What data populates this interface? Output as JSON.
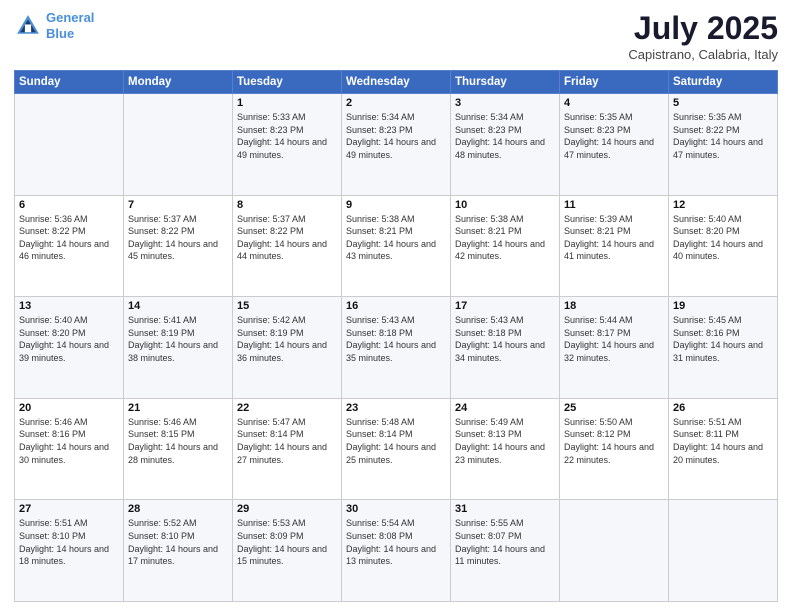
{
  "header": {
    "logo_line1": "General",
    "logo_line2": "Blue",
    "title": "July 2025",
    "subtitle": "Capistrano, Calabria, Italy"
  },
  "weekdays": [
    "Sunday",
    "Monday",
    "Tuesday",
    "Wednesday",
    "Thursday",
    "Friday",
    "Saturday"
  ],
  "weeks": [
    [
      {
        "day": "",
        "sunrise": "",
        "sunset": "",
        "daylight": ""
      },
      {
        "day": "",
        "sunrise": "",
        "sunset": "",
        "daylight": ""
      },
      {
        "day": "1",
        "sunrise": "Sunrise: 5:33 AM",
        "sunset": "Sunset: 8:23 PM",
        "daylight": "Daylight: 14 hours and 49 minutes."
      },
      {
        "day": "2",
        "sunrise": "Sunrise: 5:34 AM",
        "sunset": "Sunset: 8:23 PM",
        "daylight": "Daylight: 14 hours and 49 minutes."
      },
      {
        "day": "3",
        "sunrise": "Sunrise: 5:34 AM",
        "sunset": "Sunset: 8:23 PM",
        "daylight": "Daylight: 14 hours and 48 minutes."
      },
      {
        "day": "4",
        "sunrise": "Sunrise: 5:35 AM",
        "sunset": "Sunset: 8:23 PM",
        "daylight": "Daylight: 14 hours and 47 minutes."
      },
      {
        "day": "5",
        "sunrise": "Sunrise: 5:35 AM",
        "sunset": "Sunset: 8:22 PM",
        "daylight": "Daylight: 14 hours and 47 minutes."
      }
    ],
    [
      {
        "day": "6",
        "sunrise": "Sunrise: 5:36 AM",
        "sunset": "Sunset: 8:22 PM",
        "daylight": "Daylight: 14 hours and 46 minutes."
      },
      {
        "day": "7",
        "sunrise": "Sunrise: 5:37 AM",
        "sunset": "Sunset: 8:22 PM",
        "daylight": "Daylight: 14 hours and 45 minutes."
      },
      {
        "day": "8",
        "sunrise": "Sunrise: 5:37 AM",
        "sunset": "Sunset: 8:22 PM",
        "daylight": "Daylight: 14 hours and 44 minutes."
      },
      {
        "day": "9",
        "sunrise": "Sunrise: 5:38 AM",
        "sunset": "Sunset: 8:21 PM",
        "daylight": "Daylight: 14 hours and 43 minutes."
      },
      {
        "day": "10",
        "sunrise": "Sunrise: 5:38 AM",
        "sunset": "Sunset: 8:21 PM",
        "daylight": "Daylight: 14 hours and 42 minutes."
      },
      {
        "day": "11",
        "sunrise": "Sunrise: 5:39 AM",
        "sunset": "Sunset: 8:21 PM",
        "daylight": "Daylight: 14 hours and 41 minutes."
      },
      {
        "day": "12",
        "sunrise": "Sunrise: 5:40 AM",
        "sunset": "Sunset: 8:20 PM",
        "daylight": "Daylight: 14 hours and 40 minutes."
      }
    ],
    [
      {
        "day": "13",
        "sunrise": "Sunrise: 5:40 AM",
        "sunset": "Sunset: 8:20 PM",
        "daylight": "Daylight: 14 hours and 39 minutes."
      },
      {
        "day": "14",
        "sunrise": "Sunrise: 5:41 AM",
        "sunset": "Sunset: 8:19 PM",
        "daylight": "Daylight: 14 hours and 38 minutes."
      },
      {
        "day": "15",
        "sunrise": "Sunrise: 5:42 AM",
        "sunset": "Sunset: 8:19 PM",
        "daylight": "Daylight: 14 hours and 36 minutes."
      },
      {
        "day": "16",
        "sunrise": "Sunrise: 5:43 AM",
        "sunset": "Sunset: 8:18 PM",
        "daylight": "Daylight: 14 hours and 35 minutes."
      },
      {
        "day": "17",
        "sunrise": "Sunrise: 5:43 AM",
        "sunset": "Sunset: 8:18 PM",
        "daylight": "Daylight: 14 hours and 34 minutes."
      },
      {
        "day": "18",
        "sunrise": "Sunrise: 5:44 AM",
        "sunset": "Sunset: 8:17 PM",
        "daylight": "Daylight: 14 hours and 32 minutes."
      },
      {
        "day": "19",
        "sunrise": "Sunrise: 5:45 AM",
        "sunset": "Sunset: 8:16 PM",
        "daylight": "Daylight: 14 hours and 31 minutes."
      }
    ],
    [
      {
        "day": "20",
        "sunrise": "Sunrise: 5:46 AM",
        "sunset": "Sunset: 8:16 PM",
        "daylight": "Daylight: 14 hours and 30 minutes."
      },
      {
        "day": "21",
        "sunrise": "Sunrise: 5:46 AM",
        "sunset": "Sunset: 8:15 PM",
        "daylight": "Daylight: 14 hours and 28 minutes."
      },
      {
        "day": "22",
        "sunrise": "Sunrise: 5:47 AM",
        "sunset": "Sunset: 8:14 PM",
        "daylight": "Daylight: 14 hours and 27 minutes."
      },
      {
        "day": "23",
        "sunrise": "Sunrise: 5:48 AM",
        "sunset": "Sunset: 8:14 PM",
        "daylight": "Daylight: 14 hours and 25 minutes."
      },
      {
        "day": "24",
        "sunrise": "Sunrise: 5:49 AM",
        "sunset": "Sunset: 8:13 PM",
        "daylight": "Daylight: 14 hours and 23 minutes."
      },
      {
        "day": "25",
        "sunrise": "Sunrise: 5:50 AM",
        "sunset": "Sunset: 8:12 PM",
        "daylight": "Daylight: 14 hours and 22 minutes."
      },
      {
        "day": "26",
        "sunrise": "Sunrise: 5:51 AM",
        "sunset": "Sunset: 8:11 PM",
        "daylight": "Daylight: 14 hours and 20 minutes."
      }
    ],
    [
      {
        "day": "27",
        "sunrise": "Sunrise: 5:51 AM",
        "sunset": "Sunset: 8:10 PM",
        "daylight": "Daylight: 14 hours and 18 minutes."
      },
      {
        "day": "28",
        "sunrise": "Sunrise: 5:52 AM",
        "sunset": "Sunset: 8:10 PM",
        "daylight": "Daylight: 14 hours and 17 minutes."
      },
      {
        "day": "29",
        "sunrise": "Sunrise: 5:53 AM",
        "sunset": "Sunset: 8:09 PM",
        "daylight": "Daylight: 14 hours and 15 minutes."
      },
      {
        "day": "30",
        "sunrise": "Sunrise: 5:54 AM",
        "sunset": "Sunset: 8:08 PM",
        "daylight": "Daylight: 14 hours and 13 minutes."
      },
      {
        "day": "31",
        "sunrise": "Sunrise: 5:55 AM",
        "sunset": "Sunset: 8:07 PM",
        "daylight": "Daylight: 14 hours and 11 minutes."
      },
      {
        "day": "",
        "sunrise": "",
        "sunset": "",
        "daylight": ""
      },
      {
        "day": "",
        "sunrise": "",
        "sunset": "",
        "daylight": ""
      }
    ]
  ]
}
